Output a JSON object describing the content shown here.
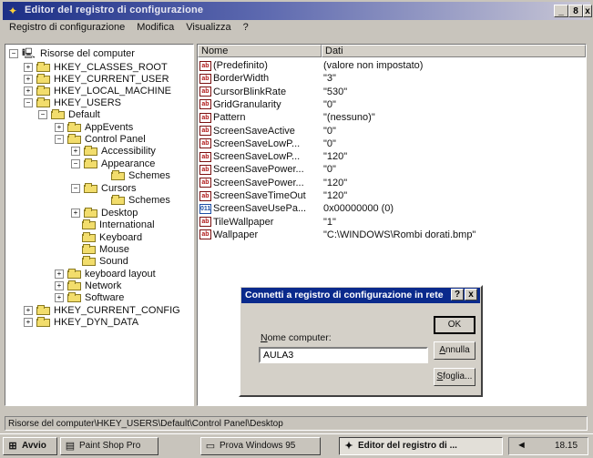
{
  "window": {
    "title": "Editor del registro di configurazione",
    "buttons": [
      "_",
      "8",
      "x"
    ]
  },
  "menu": [
    "Registro di configurazione",
    "Modifica",
    "Visualizza",
    "?"
  ],
  "tree": [
    {
      "label": "Risorse del computer",
      "toggle": "-",
      "icon": "computer-icon"
    },
    {
      "label": "HKEY_CLASSES_ROOT",
      "toggle": "+"
    },
    {
      "label": "HKEY_CURRENT_USER",
      "toggle": "+"
    },
    {
      "label": "HKEY_LOCAL_MACHINE",
      "toggle": "+"
    },
    {
      "label": "HKEY_USERS",
      "toggle": "-"
    },
    {
      "label": "Default",
      "toggle": "-"
    },
    {
      "label": "AppEvents",
      "toggle": "+"
    },
    {
      "label": "Control Panel",
      "toggle": "-"
    },
    {
      "label": "Accessibility",
      "toggle": "+"
    },
    {
      "label": "Appearance",
      "toggle": "-"
    },
    {
      "label": "Schemes",
      "toggle": ""
    },
    {
      "label": "Cursors",
      "toggle": "-"
    },
    {
      "label": "Schemes",
      "toggle": ""
    },
    {
      "label": "Desktop",
      "toggle": "+"
    },
    {
      "label": "International",
      "toggle": ""
    },
    {
      "label": "Keyboard",
      "toggle": ""
    },
    {
      "label": "Mouse",
      "toggle": ""
    },
    {
      "label": "Sound",
      "toggle": ""
    },
    {
      "label": "keyboard layout",
      "toggle": "+"
    },
    {
      "label": "Network",
      "toggle": "+"
    },
    {
      "label": "Software",
      "toggle": "+"
    },
    {
      "label": "HKEY_CURRENT_CONFIG",
      "toggle": "+"
    },
    {
      "label": "HKEY_DYN_DATA",
      "toggle": "+"
    }
  ],
  "list": {
    "columns": [
      "Nome",
      "Dati"
    ],
    "rows": [
      {
        "name": "(Predefinito)",
        "value": "(valore non impostato)",
        "type": "ab"
      },
      {
        "name": "BorderWidth",
        "value": "\"3\"",
        "type": "ab"
      },
      {
        "name": "CursorBlinkRate",
        "value": "\"530\"",
        "type": "ab"
      },
      {
        "name": "GridGranularity",
        "value": "\"0\"",
        "type": "ab"
      },
      {
        "name": "Pattern",
        "value": "\"(nessuno)\"",
        "type": "ab"
      },
      {
        "name": "ScreenSaveActive",
        "value": "\"0\"",
        "type": "ab"
      },
      {
        "name": "ScreenSaveLowP...",
        "value": "\"0\"",
        "type": "ab"
      },
      {
        "name": "ScreenSaveLowP...",
        "value": "\"120\"",
        "type": "ab"
      },
      {
        "name": "ScreenSavePower...",
        "value": "\"0\"",
        "type": "ab"
      },
      {
        "name": "ScreenSavePower...",
        "value": "\"120\"",
        "type": "ab"
      },
      {
        "name": "ScreenSaveTimeOut",
        "value": "\"120\"",
        "type": "ab"
      },
      {
        "name": "ScreenSaveUsePa...",
        "value": "0x00000000 (0)",
        "type": "bin"
      },
      {
        "name": "TileWallpaper",
        "value": "\"1\"",
        "type": "ab"
      },
      {
        "name": "Wallpaper",
        "value": "\"C:\\WINDOWS\\Rombi dorati.bmp\"",
        "type": "ab"
      }
    ]
  },
  "dialog": {
    "title": "Connetti a registro di configurazione in rete",
    "field_label": "Nome computer:",
    "field_value": "AULA3",
    "ok_label": "OK",
    "cancel_label": "Annulla",
    "browse_label": "Sfoglia...",
    "help_label": "?",
    "close_label": "x"
  },
  "status_path": "Risorse del computer\\HKEY_USERS\\Default\\Control Panel\\Desktop",
  "taskbar": {
    "start_label": "Avvio",
    "items": [
      "Paint Shop Pro",
      "Prova Windows 95",
      "Editor del registro di ..."
    ],
    "clock": "18.15"
  }
}
